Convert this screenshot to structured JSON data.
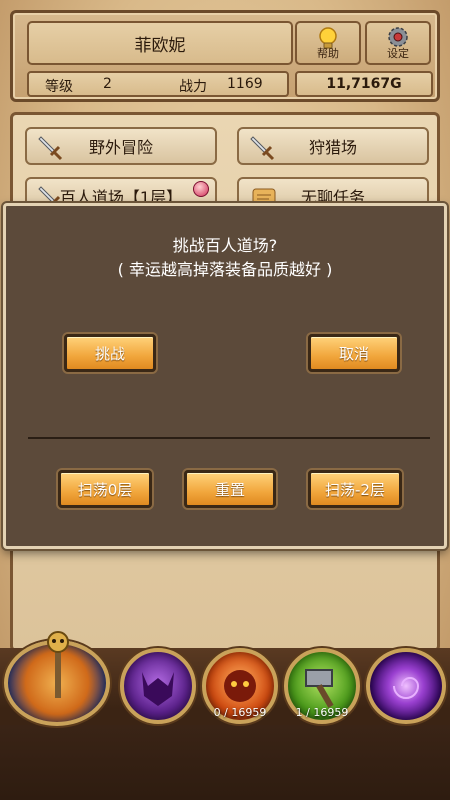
{
  "header": {
    "player_name": "菲欧妮",
    "help_label": "帮助",
    "settings_label": "设定",
    "level_label": "等级",
    "level_value": "2",
    "power_label": "战力",
    "power_value": "1169",
    "gold": "11,7167G"
  },
  "menu": {
    "items": [
      {
        "label": "野外冒险",
        "icon": "sword-icon"
      },
      {
        "label": "狩猎场",
        "icon": "sword-icon"
      },
      {
        "label": "百人道场【1层】",
        "icon": "sword-icon"
      },
      {
        "label": "无聊任务",
        "icon": "scroll-icon"
      }
    ]
  },
  "dialog": {
    "title_line1": "挑战百人道场?",
    "title_line2": "( 幸运越高掉落装备品质越好 )",
    "challenge_label": "挑战",
    "cancel_label": "取消",
    "sweep0_label": "扫荡0层",
    "reset_label": "重置",
    "sweep_neg2_label": "扫荡-2层"
  },
  "bottom": {
    "orbs": [
      {
        "icon": "hero-orb-icon",
        "count": ""
      },
      {
        "icon": "demon-orb-icon",
        "count": ""
      },
      {
        "icon": "fire-demon-orb-icon",
        "count": "0 / 16959"
      },
      {
        "icon": "hammer-orb-icon",
        "count": "1 / 16959"
      },
      {
        "icon": "portal-orb-icon",
        "count": ""
      }
    ]
  },
  "colors": {
    "parchment": "#e9d3a9",
    "dialog_bg": "#5c4a3a",
    "button_orange": "#f1a63c",
    "wood_dark": "#3b2414"
  }
}
